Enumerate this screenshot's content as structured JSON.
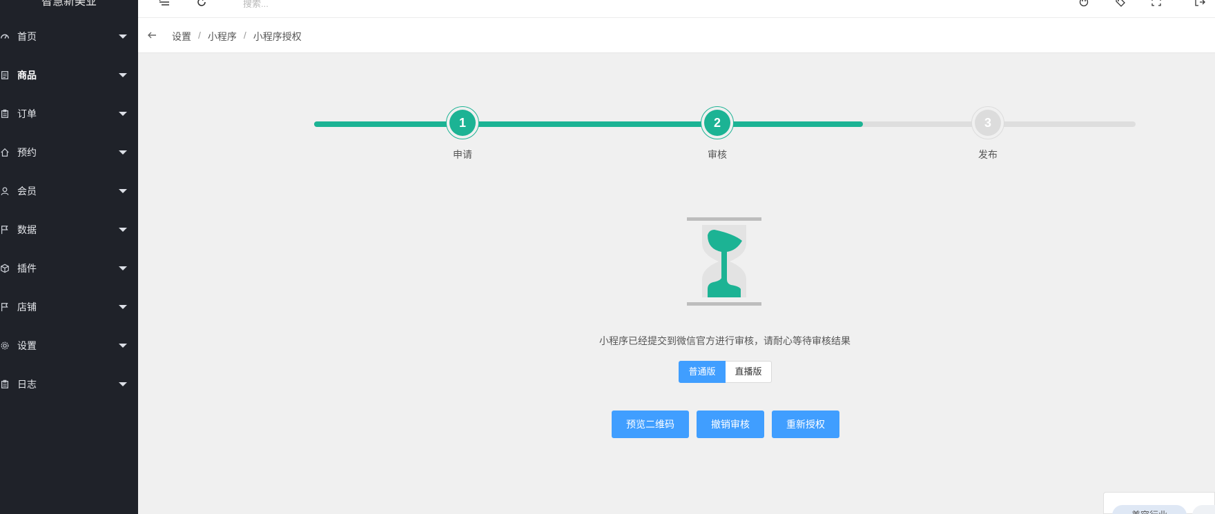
{
  "sidebar": {
    "brand": "智慧新美业",
    "items": [
      {
        "label": "首页",
        "icon": "dashboard-icon"
      },
      {
        "label": "商品",
        "icon": "document-icon",
        "active": true
      },
      {
        "label": "订单",
        "icon": "clipboard-icon"
      },
      {
        "label": "预约",
        "icon": "home-icon"
      },
      {
        "label": "会员",
        "icon": "user-icon"
      },
      {
        "label": "数据",
        "icon": "flag-icon"
      },
      {
        "label": "插件",
        "icon": "cube-icon"
      },
      {
        "label": "店铺",
        "icon": "flag-icon"
      },
      {
        "label": "设置",
        "icon": "gear-icon"
      },
      {
        "label": "日志",
        "icon": "clipboard-icon"
      }
    ]
  },
  "header": {
    "search_placeholder": "搜索..."
  },
  "breadcrumb": {
    "items": [
      "设置",
      "小程序",
      "小程序授权"
    ],
    "separator": "/"
  },
  "steps": [
    {
      "number": "1",
      "label": "申请",
      "status": "done"
    },
    {
      "number": "2",
      "label": "审核",
      "status": "current"
    },
    {
      "number": "3",
      "label": "发布",
      "status": "pending"
    }
  ],
  "progress_fraction": 0.67,
  "status_message": "小程序已经提交到微信官方进行审核，请耐心等待审核结果",
  "version_toggle": {
    "options": [
      "普通版",
      "直播版"
    ],
    "selected": "普通版"
  },
  "actions": {
    "preview_qr": "预览二维码",
    "cancel_review": "撤销审核",
    "reauthorize": "重新授权"
  },
  "corner_chip": "美容行业",
  "colors": {
    "sidebar_bg": "#1f2229",
    "accent_green": "#1cb394",
    "primary_blue": "#409eff",
    "page_bg": "#f0f0f0"
  }
}
